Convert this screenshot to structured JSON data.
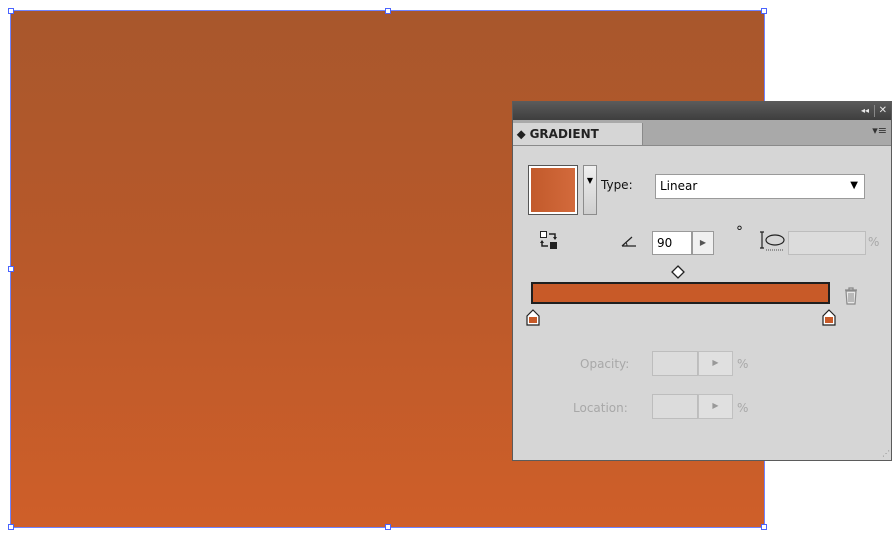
{
  "panel": {
    "tab_label": "⬥ GRADIENT",
    "collapse_glyph": "◂◂",
    "close_glyph": "✕",
    "menu_glyph": "▾≡",
    "type_label": "Type:",
    "type_value": "Linear",
    "angle_value": "90",
    "degree_symbol": "°",
    "aspect_value": "",
    "aspect_unit": "%",
    "opacity_label": "Opacity:",
    "opacity_value": "",
    "opacity_unit": "%",
    "location_label": "Location:",
    "location_value": "",
    "location_unit": "%"
  },
  "gradient": {
    "top_color": "#a8572c",
    "bottom_color": "#cf5f29",
    "stop_colors": [
      "#c85a28",
      "#c85a28"
    ]
  },
  "icons": [
    "reverse-gradient-icon",
    "angle-icon",
    "aspect-ratio-icon",
    "trash-icon",
    "midpoint-diamond-icon",
    "color-stop-icon"
  ]
}
